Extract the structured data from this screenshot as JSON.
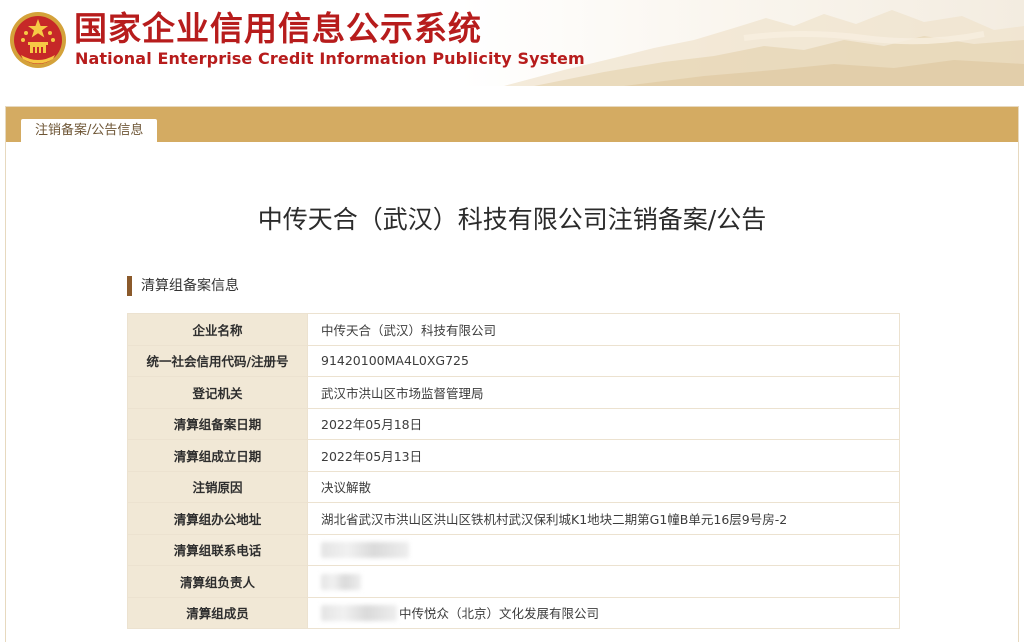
{
  "brand": {
    "title_cn": "国家企业信用信息公示系统",
    "title_en": "National Enterprise Credit Information Publicity System"
  },
  "tabs": [
    {
      "label": "注销备案/公告信息",
      "active": true
    }
  ],
  "page_title": "中传天合（武汉）科技有限公司注销备案/公告",
  "section": {
    "heading": "清算组备案信息"
  },
  "rows": [
    {
      "label": "企业名称",
      "value": "中传天合（武汉）科技有限公司"
    },
    {
      "label": "统一社会信用代码/注册号",
      "value": "91420100MA4L0XG725"
    },
    {
      "label": "登记机关",
      "value": "武汉市洪山区市场监督管理局"
    },
    {
      "label": "清算组备案日期",
      "value": "2022年05月18日"
    },
    {
      "label": "清算组成立日期",
      "value": "2022年05月13日"
    },
    {
      "label": "注销原因",
      "value": "决议解散"
    },
    {
      "label": "清算组办公地址",
      "value": "湖北省武汉市洪山区洪山区铁机村武汉保利城K1地块二期第G1幢B单元16层9号房-2"
    },
    {
      "label": "清算组联系电话",
      "value": ""
    },
    {
      "label": "清算组负责人",
      "value": ""
    },
    {
      "label": "清算组成员",
      "value": "中传悦众（北京）文化发展有限公司"
    }
  ],
  "colors": {
    "brand_red": "#b71c1c",
    "tab_bar": "#d4ab62",
    "label_bg": "#f1e8d6",
    "section_marker": "#8b5a2b"
  }
}
